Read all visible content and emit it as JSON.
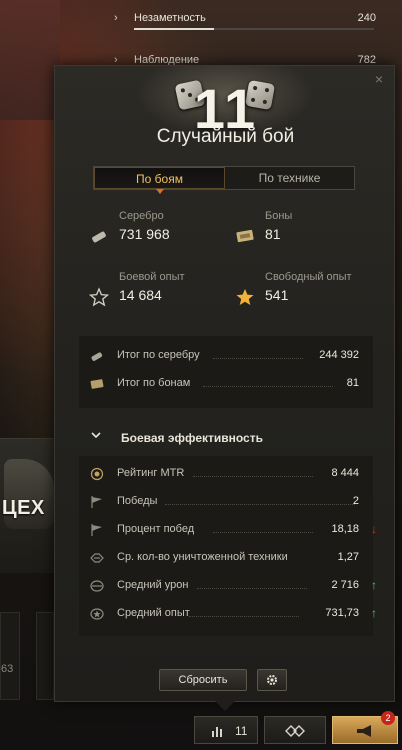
{
  "background": {
    "tank_label": "ЦЕХ",
    "card_value": "63",
    "skills": [
      {
        "name": "Незаметность",
        "value": "240"
      },
      {
        "name": "Наблюдение",
        "value": "782"
      }
    ]
  },
  "popup": {
    "battle_count": "11",
    "battle_type": "Случайный бой",
    "tabs": [
      {
        "label": "По боям",
        "active": true
      },
      {
        "label": "По технике",
        "active": false
      }
    ],
    "summary": {
      "silver": {
        "label": "Серебро",
        "value": "731 968",
        "icon": "silver-icon"
      },
      "bonds": {
        "label": "Боны",
        "value": "81",
        "icon": "bonds-icon"
      },
      "battle_xp": {
        "label": "Боевой опыт",
        "value": "14 684",
        "icon": "star-outline-icon"
      },
      "free_xp": {
        "label": "Свободный опыт",
        "value": "541",
        "icon": "star-gold-icon"
      }
    },
    "totals": [
      {
        "label": "Итог по серебру",
        "value": "244 392",
        "icon": "silver-icon"
      },
      {
        "label": "Итог по бонам",
        "value": "81",
        "icon": "bonds-icon"
      }
    ],
    "efficiency": {
      "header": "Боевая эффективность",
      "rows": [
        {
          "label": "Рейтинг MTR",
          "value": "8 444",
          "icon": "mtr-rating-icon",
          "trend": ""
        },
        {
          "label": "Победы",
          "value": "2",
          "icon": "flag-icon",
          "trend": ""
        },
        {
          "label": "Процент побед",
          "value": "18,18",
          "icon": "flag-icon",
          "trend": "down"
        },
        {
          "label": "Ср. кол-во уничтоженной техники",
          "value": "1,27",
          "icon": "destroyed-vehicles-icon",
          "trend": ""
        },
        {
          "label": "Средний урон",
          "value": "2 716",
          "icon": "damage-icon",
          "trend": "up"
        },
        {
          "label": "Средний опыт",
          "value": "731,73",
          "icon": "xp-icon",
          "trend": "up"
        }
      ]
    },
    "reset_label": "Сбросить",
    "colors": {
      "up": "#3fd24a",
      "down": "#e02a1f",
      "accent": "#f0c060"
    }
  },
  "bottom_bar": {
    "battles_count": "11",
    "badge": "2"
  }
}
